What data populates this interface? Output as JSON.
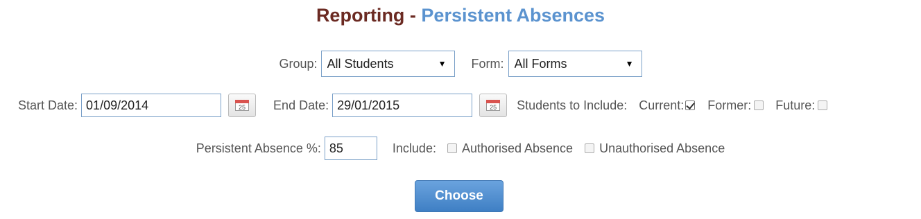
{
  "header": {
    "title_main": "Reporting - ",
    "title_sub": "Persistent Absences"
  },
  "filters": {
    "group_label": "Group:",
    "group_value": "All Students",
    "form_label": "Form:",
    "form_value": "All Forms"
  },
  "dates": {
    "start_label": "Start Date:",
    "start_value": "01/09/2014",
    "end_label": "End Date:",
    "end_value": "29/01/2015",
    "calendar_day": "25"
  },
  "students": {
    "label": "Students to Include:",
    "current_label": "Current:",
    "current_checked": true,
    "former_label": "Former:",
    "former_checked": false,
    "future_label": "Future:",
    "future_checked": false
  },
  "absence": {
    "percent_label": "Persistent Absence %:",
    "percent_value": "85",
    "include_label": "Include:",
    "authorised_label": "Authorised Absence",
    "authorised_checked": false,
    "unauthorised_label": "Unauthorised Absence",
    "unauthorised_checked": false
  },
  "actions": {
    "choose_label": "Choose"
  },
  "colors": {
    "title_main": "#6b2a22",
    "title_sub": "#5b93cf",
    "button": "#4a89cc"
  },
  "icons": {
    "calendar": "calendar-icon",
    "dropdown": "triangle-down-icon"
  }
}
